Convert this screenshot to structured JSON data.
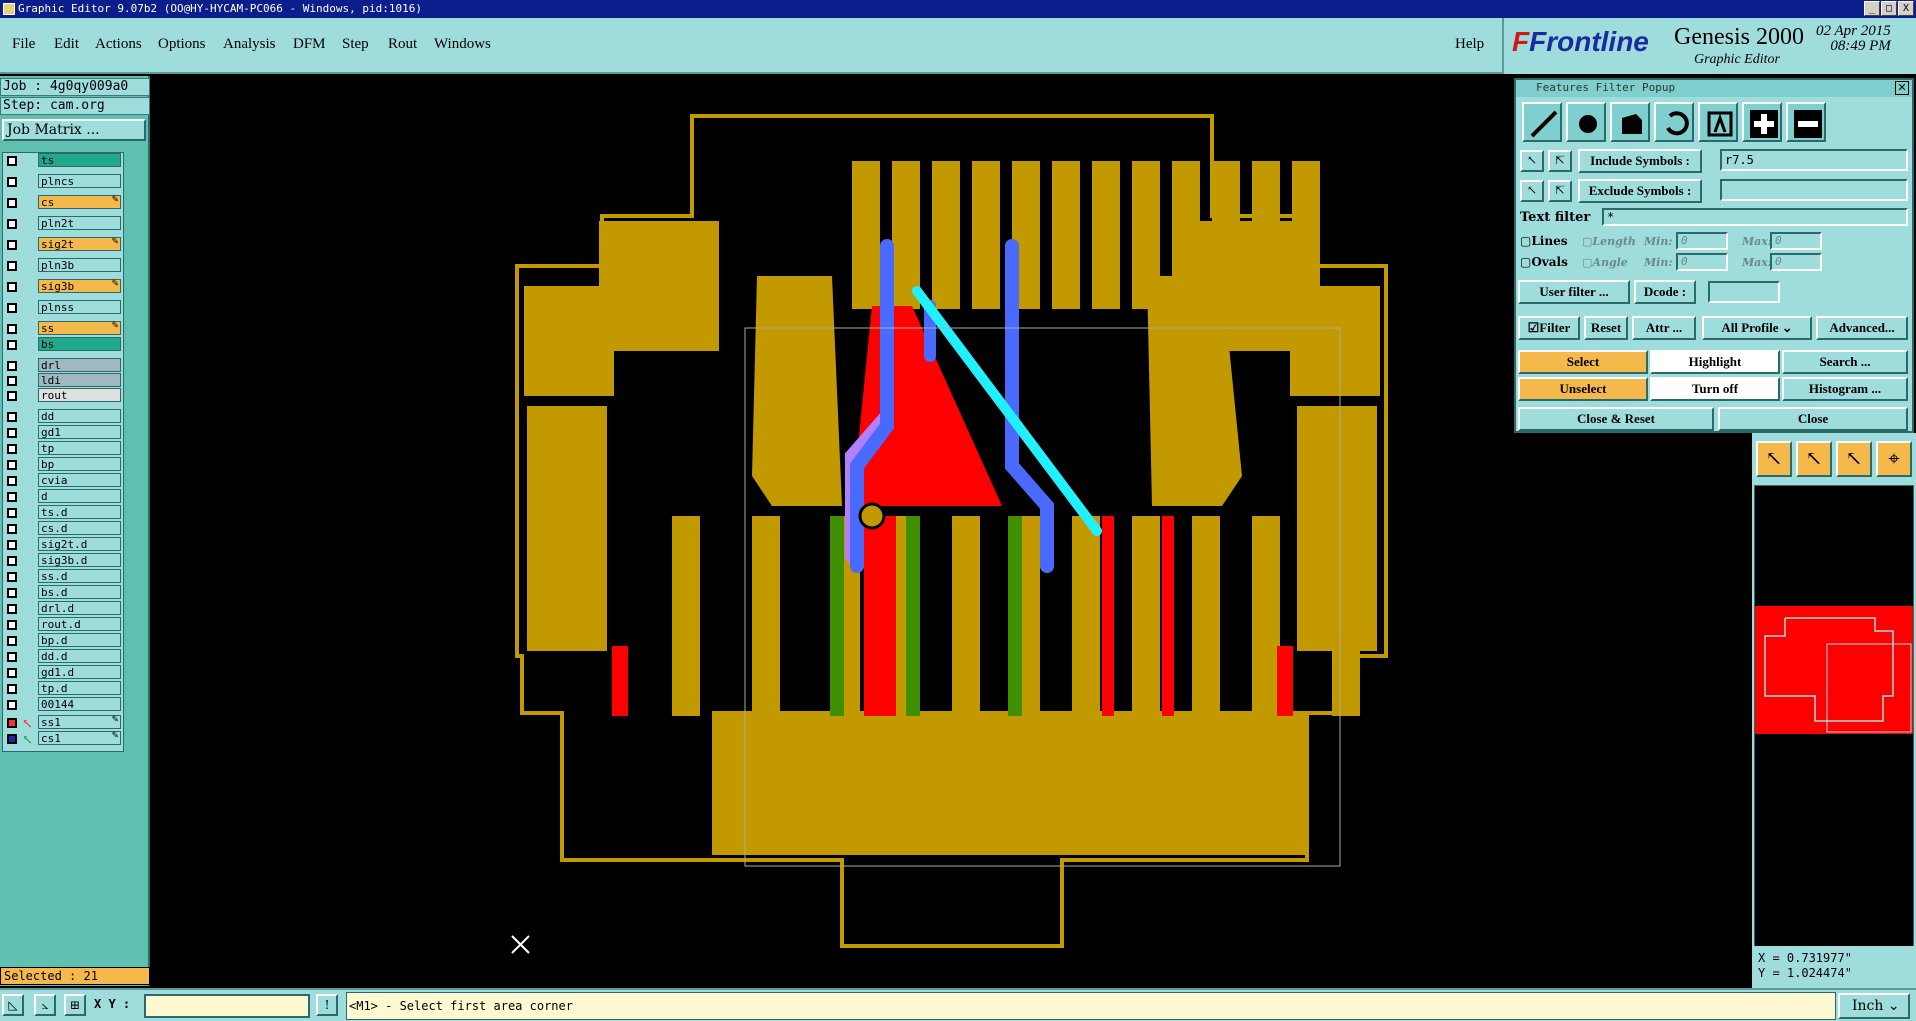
{
  "window": {
    "title": "Graphic Editor 9.07b2 (OO@HY-HYCAM-PC066 - Windows, pid:1016)",
    "buttons": [
      "_",
      "□",
      "X"
    ]
  },
  "menu": [
    "File",
    "Edit",
    "Actions",
    "Options",
    "Analysis",
    "DFM",
    "Step",
    "Rout",
    "Windows"
  ],
  "help": "Help",
  "brand": {
    "logo_f": "F",
    "logo_rest": "Frontline",
    "product": "Genesis 2000",
    "subtitle": "Graphic Editor",
    "date": "02 Apr 2015",
    "time": "08:49 PM"
  },
  "job": {
    "job_label": "Job : 4g0qy009a0",
    "step_label": "Step: cam.org",
    "matrix_button": "Job Matrix ..."
  },
  "layers": [
    {
      "name": "ts",
      "color": "#1fa88a",
      "edit": false
    },
    {
      "name": "plncs",
      "color": "#9fdcdc",
      "edit": false
    },
    {
      "name": "cs",
      "color": "#f5b84a",
      "edit": true
    },
    {
      "name": "pln2t",
      "color": "#9fdcdc",
      "edit": false
    },
    {
      "name": "sig2t",
      "color": "#f5b84a",
      "edit": true
    },
    {
      "name": "pln3b",
      "color": "#9fdcdc",
      "edit": false
    },
    {
      "name": "sig3b",
      "color": "#f5b84a",
      "edit": true
    },
    {
      "name": "plnss",
      "color": "#9fdcdc",
      "edit": false
    },
    {
      "name": "ss",
      "color": "#f5b84a",
      "edit": true
    },
    {
      "name": "bs",
      "color": "#1fa88a",
      "edit": false
    },
    {
      "name": "drl",
      "color": "#a0b8c0",
      "edit": false
    },
    {
      "name": "ldi",
      "color": "#a0b8c0",
      "edit": false
    },
    {
      "name": "rout",
      "color": "#e0e0e0",
      "edit": false
    },
    {
      "name": "dd",
      "color": "#9fdcdc",
      "edit": false
    },
    {
      "name": "gd1",
      "color": "#9fdcdc",
      "edit": false
    },
    {
      "name": "tp",
      "color": "#9fdcdc",
      "edit": false
    },
    {
      "name": "bp",
      "color": "#9fdcdc",
      "edit": false
    },
    {
      "name": "cvia",
      "color": "#9fdcdc",
      "edit": false
    },
    {
      "name": "d",
      "color": "#9fdcdc",
      "edit": false
    },
    {
      "name": "ts.d",
      "color": "#9fdcdc",
      "edit": false
    },
    {
      "name": "cs.d",
      "color": "#9fdcdc",
      "edit": false
    },
    {
      "name": "sig2t.d",
      "color": "#9fdcdc",
      "edit": false
    },
    {
      "name": "sig3b.d",
      "color": "#9fdcdc",
      "edit": false
    },
    {
      "name": "ss.d",
      "color": "#9fdcdc",
      "edit": false
    },
    {
      "name": "bs.d",
      "color": "#9fdcdc",
      "edit": false
    },
    {
      "name": "drl.d",
      "color": "#9fdcdc",
      "edit": false
    },
    {
      "name": "rout.d",
      "color": "#9fdcdc",
      "edit": false
    },
    {
      "name": "bp.d",
      "color": "#9fdcdc",
      "edit": false
    },
    {
      "name": "dd.d",
      "color": "#9fdcdc",
      "edit": false
    },
    {
      "name": "gd1.d",
      "color": "#9fdcdc",
      "edit": false
    },
    {
      "name": "tp.d",
      "color": "#9fdcdc",
      "edit": false
    },
    {
      "name": "00144",
      "color": "#9fdcdc",
      "edit": false
    },
    {
      "name": "ss1",
      "color": "#9fdcdc",
      "edit": true
    },
    {
      "name": "cs1",
      "color": "#9fdcdc",
      "edit": true
    }
  ],
  "selected": "Selected : 21",
  "filter_popup": {
    "title": "Features Filter Popup",
    "include_label": "Include Symbols :",
    "include_value": "r7.5",
    "exclude_label": "Exclude Symbols :",
    "exclude_value": "",
    "text_filter_label": "Text filter",
    "text_filter_value": "*",
    "lines": "Lines",
    "ovals": "Ovals",
    "length": "Length",
    "angle": "Angle",
    "min": "Min:",
    "max": "Max:",
    "zero": "0",
    "user_filter": "User filter ...",
    "dcode": "Dcode :",
    "filter": "Filter",
    "reset": "Reset",
    "attr": "Attr ...",
    "all_profile": "All Profile",
    "advanced": "Advanced...",
    "select": "Select",
    "highlight": "Highlight",
    "search": "Search ...",
    "unselect": "Unselect",
    "turn_off": "Turn off",
    "histogram": "Histogram ...",
    "close_reset": "Close & Reset",
    "close": "Close"
  },
  "coords": {
    "x": "X = 0.731977\"",
    "y": "Y = 1.024474\""
  },
  "bottom": {
    "xy_label": "X Y :",
    "xy_value": "",
    "status": "<M1> - Select first area corner",
    "units": "Inch"
  },
  "colors": {
    "copper": "#c29a00",
    "red": "#ff0000",
    "blue": "#4a6aff",
    "cyan": "#22f0ff",
    "green": "#3f8f00",
    "violet": "#b080ff"
  }
}
